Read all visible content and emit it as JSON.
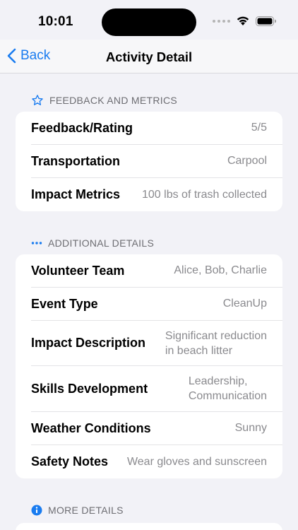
{
  "status": {
    "time": "10:01"
  },
  "nav": {
    "back_label": "Back",
    "title": "Activity Detail"
  },
  "sections": {
    "feedback": {
      "header": "FEEDBACK AND METRICS",
      "icon": "star-icon",
      "rows": [
        {
          "label": "Feedback/Rating",
          "value": "5/5"
        },
        {
          "label": "Transportation",
          "value": "Carpool"
        },
        {
          "label": "Impact Metrics",
          "value": "100 lbs of trash collected"
        }
      ]
    },
    "additional": {
      "header": "ADDITIONAL DETAILS",
      "icon": "ellipsis-icon",
      "rows": [
        {
          "label": "Volunteer Team",
          "value": "Alice,  Bob,  Charlie"
        },
        {
          "label": "Event Type",
          "value": "CleanUp"
        },
        {
          "label": "Impact Description",
          "value_line1": "Significant reduction",
          "value_line2": "in beach litter"
        },
        {
          "label": "Skills Development",
          "value_line1": "Leadership,",
          "value_line2": "Communication"
        },
        {
          "label": "Weather Conditions",
          "value": "Sunny"
        },
        {
          "label": "Safety Notes",
          "value": "Wear gloves and sunscreen"
        }
      ]
    },
    "more": {
      "header": "MORE DETAILS",
      "icon": "info-icon"
    }
  },
  "colors": {
    "accent": "#1a7cf0",
    "background": "#f2f2f7",
    "secondary_text": "#8a8a8e"
  }
}
